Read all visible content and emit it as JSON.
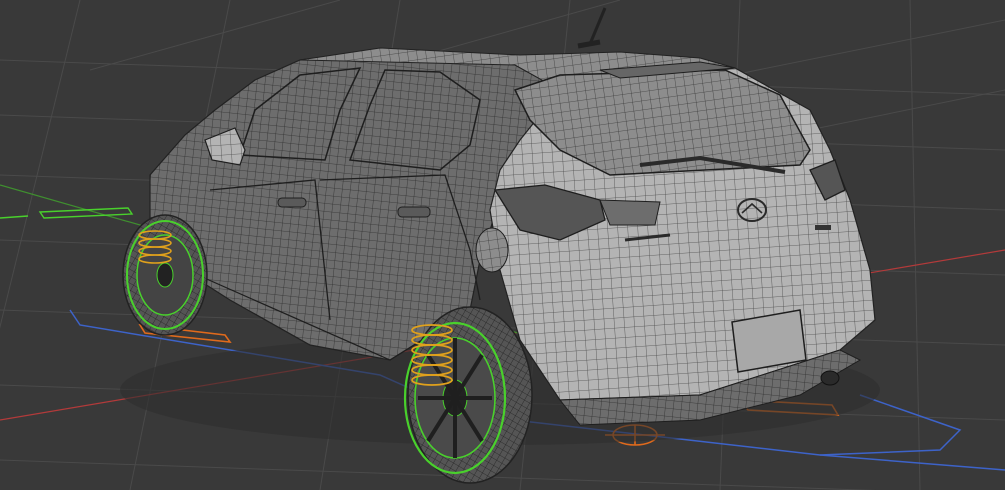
{
  "viewport": {
    "background": "#393939",
    "grid_color": "#4a4a4a",
    "axis_x_color": "#b33a3a",
    "axis_y_color": "#3f8f2f",
    "boundary_color": "#3d63c9",
    "helper_orange": "#e06a1c"
  },
  "model": {
    "body_color": "#8a8a8a",
    "wire_color": "#2b2b2b",
    "wheel_rig_color": "#49d12c",
    "spring_color": "#e0a11c",
    "icons": [
      "car-model",
      "wheel-rig",
      "suspension-spring",
      "exhaust-pipe",
      "antenna",
      "rear-wiper",
      "door-handle",
      "side-mirror",
      "taillight",
      "brand-logo",
      "license-plate"
    ]
  }
}
